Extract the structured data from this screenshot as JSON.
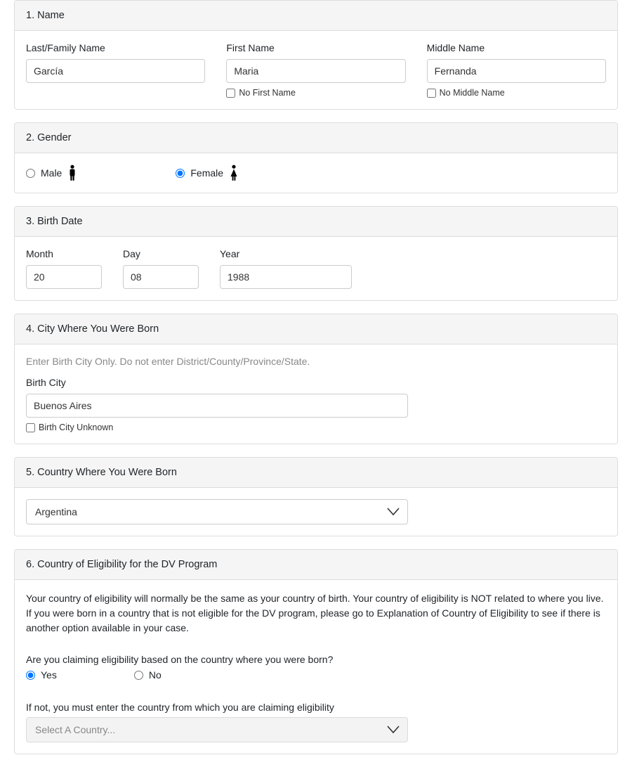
{
  "section1": {
    "title": "1. Name",
    "lastName": {
      "label": "Last/Family Name",
      "value": "García"
    },
    "firstName": {
      "label": "First Name",
      "value": "Maria",
      "noLabel": "No First Name"
    },
    "middleName": {
      "label": "Middle Name",
      "value": "Fernanda",
      "noLabel": "No Middle Name"
    }
  },
  "section2": {
    "title": "2. Gender",
    "male": "Male",
    "female": "Female"
  },
  "section3": {
    "title": "3. Birth Date",
    "month": {
      "label": "Month",
      "value": "20"
    },
    "day": {
      "label": "Day",
      "value": "08"
    },
    "year": {
      "label": "Year",
      "value": "1988"
    }
  },
  "section4": {
    "title": "4. City Where You Were Born",
    "hint": "Enter Birth City Only. Do not enter District/County/Province/State.",
    "label": "Birth City",
    "value": "Buenos Aires",
    "unknownLabel": "Birth City Unknown"
  },
  "section5": {
    "title": "5. Country Where You Were Born",
    "value": "Argentina"
  },
  "section6": {
    "title": "6. Country of Eligibility for the DV Program",
    "desc": "Your country of eligibility will normally be the same as your country of birth. Your country of eligibility is NOT related to where you live. If you were born in a country that is not eligible for the DV program, please go to Explanation of Country of Eligibility to see if there is another option available in your case.",
    "question1": "Are you claiming eligibility based on the country where you were born?",
    "yes": "Yes",
    "no": "No",
    "question2": "If not, you must enter the country from which you are claiming eligibility",
    "selectPlaceholder": "Select A Country..."
  }
}
